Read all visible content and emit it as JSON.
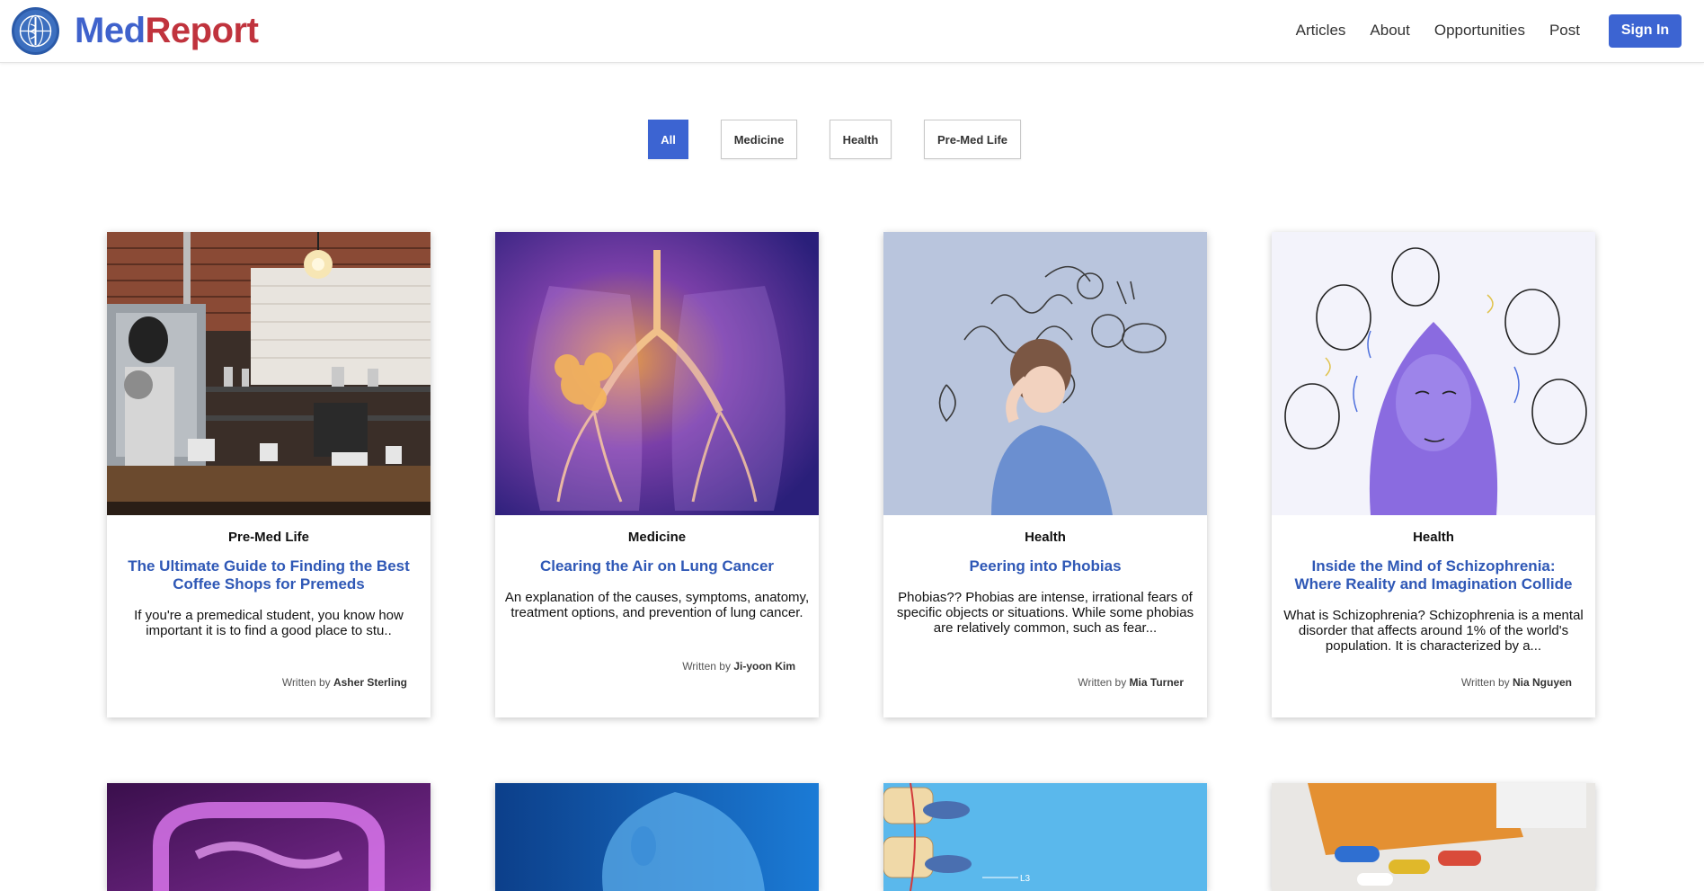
{
  "brand": {
    "name_part1": "Med",
    "name_part2": "Report",
    "logo_icon": "globe-caduceus-icon"
  },
  "nav": {
    "items": [
      "Articles",
      "About",
      "Opportunities",
      "Post"
    ],
    "signin_label": "Sign In"
  },
  "filters": [
    {
      "label": "All",
      "active": true
    },
    {
      "label": "Medicine",
      "active": false
    },
    {
      "label": "Health",
      "active": false
    },
    {
      "label": "Pre-Med Life",
      "active": false
    }
  ],
  "articles": [
    {
      "category": "Pre-Med Life",
      "title": "The Ultimate Guide to Finding the Best Coffee Shops for Premeds",
      "excerpt": "If you're a premedical student, you know how important it is to find a good place to stu..",
      "written_by": "Written by",
      "author": "Asher Sterling",
      "image": "coffee-shop-photo"
    },
    {
      "category": "Medicine",
      "title": "Clearing the Air on Lung Cancer",
      "excerpt": "An explanation of the causes, symptoms, anatomy, treatment options, and prevention of lung cancer.",
      "written_by": "Written by",
      "author": "Ji-yoon Kim",
      "image": "lung-xray-illustration"
    },
    {
      "category": "Health",
      "title": "Peering into Phobias",
      "excerpt": "Phobias?? Phobias are intense, irrational fears of specific objects or situations. While some phobias are relatively common, such as fear...",
      "written_by": "Written by",
      "author": "Mia Turner",
      "image": "anxious-woman-illustration"
    },
    {
      "category": "Health",
      "title": "Inside the Mind of Schizophrenia: Where Reality and Imagination Collide",
      "excerpt": "What is Schizophrenia? Schizophrenia is a mental disorder that affects around 1% of the world's population. It is characterized by a...",
      "written_by": "Written by",
      "author": "Nia Nguyen",
      "image": "faces-illustration"
    }
  ],
  "row2_images": [
    "intestine-xray-image",
    "head-anatomy-image",
    "spine-vertebrae-image",
    "pill-bottle-image"
  ],
  "row2_labels": {
    "spine_label": "L3"
  },
  "colors": {
    "accent": "#3c64d2",
    "title_link": "#2f58b6",
    "brand_blue": "#3f62cc",
    "brand_red": "#c0333d"
  }
}
